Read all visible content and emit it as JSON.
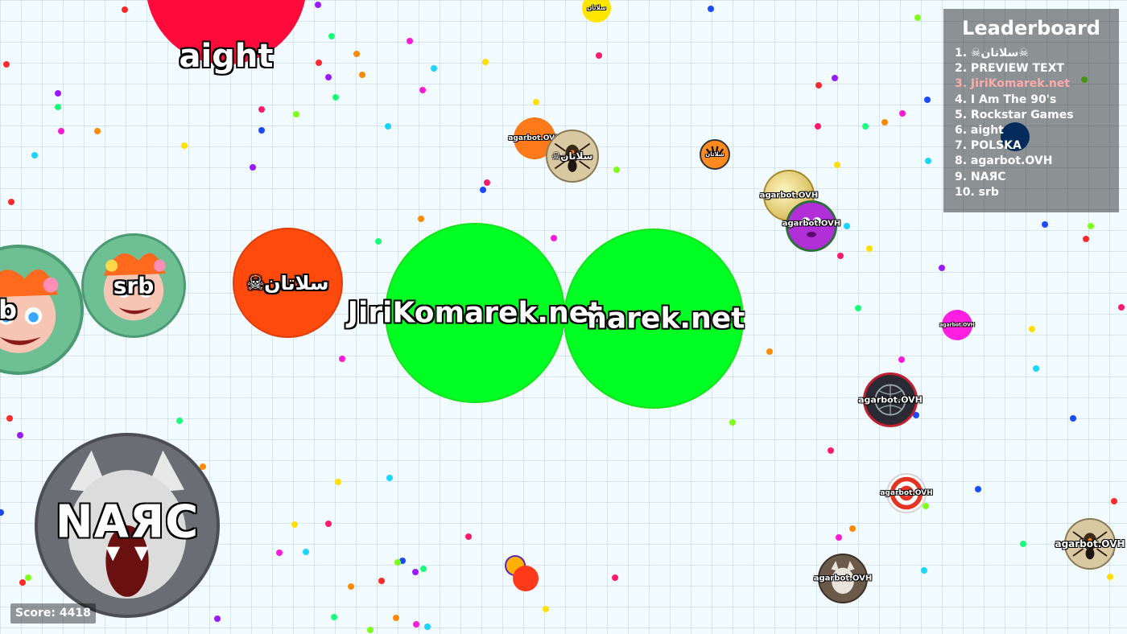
{
  "leaderboard": {
    "title": "Leaderboard",
    "entries": [
      "1. ☠سلاتان☠",
      "2. PREVIEW TEXT",
      "3. JiriKomarek.net",
      "4. I Am The 90's",
      "5. Rockstar Games",
      "6. aight",
      "7. POLSKA",
      "8. agarbot.OVH",
      "9. NAЯC",
      "10. srb"
    ],
    "highlight_color": "#ffaaaa"
  },
  "score": {
    "label": "Score: 4418"
  },
  "cells": {
    "player_a": "JiriKomarek.net",
    "player_b": "JiriKomarek.net",
    "sultan": "☠سلاتان",
    "narc": "NAЯC",
    "srb_left": "srb",
    "srb_right": "srb",
    "top_red": "aight",
    "orange_small": "agarbot.OVH",
    "spider_top": "☠سلاتان",
    "tiger_small": "سلاتان",
    "gold": "agarbot.OVH",
    "purple": "agarbot.OVH",
    "magenta_small": "agarbot.OVH",
    "grid_ball": "agarbot.OVH",
    "target": "agarbot.OVH",
    "wolf_small": "agarbot.OVH",
    "spider_right": "agarbot.OVH",
    "yellow_top": "سلاتان"
  },
  "colors": {
    "player_green": "#00ff22",
    "sultan_orange": "#ff4a0e",
    "top_red": "#ff0a3a",
    "background": "#f2fbff"
  }
}
